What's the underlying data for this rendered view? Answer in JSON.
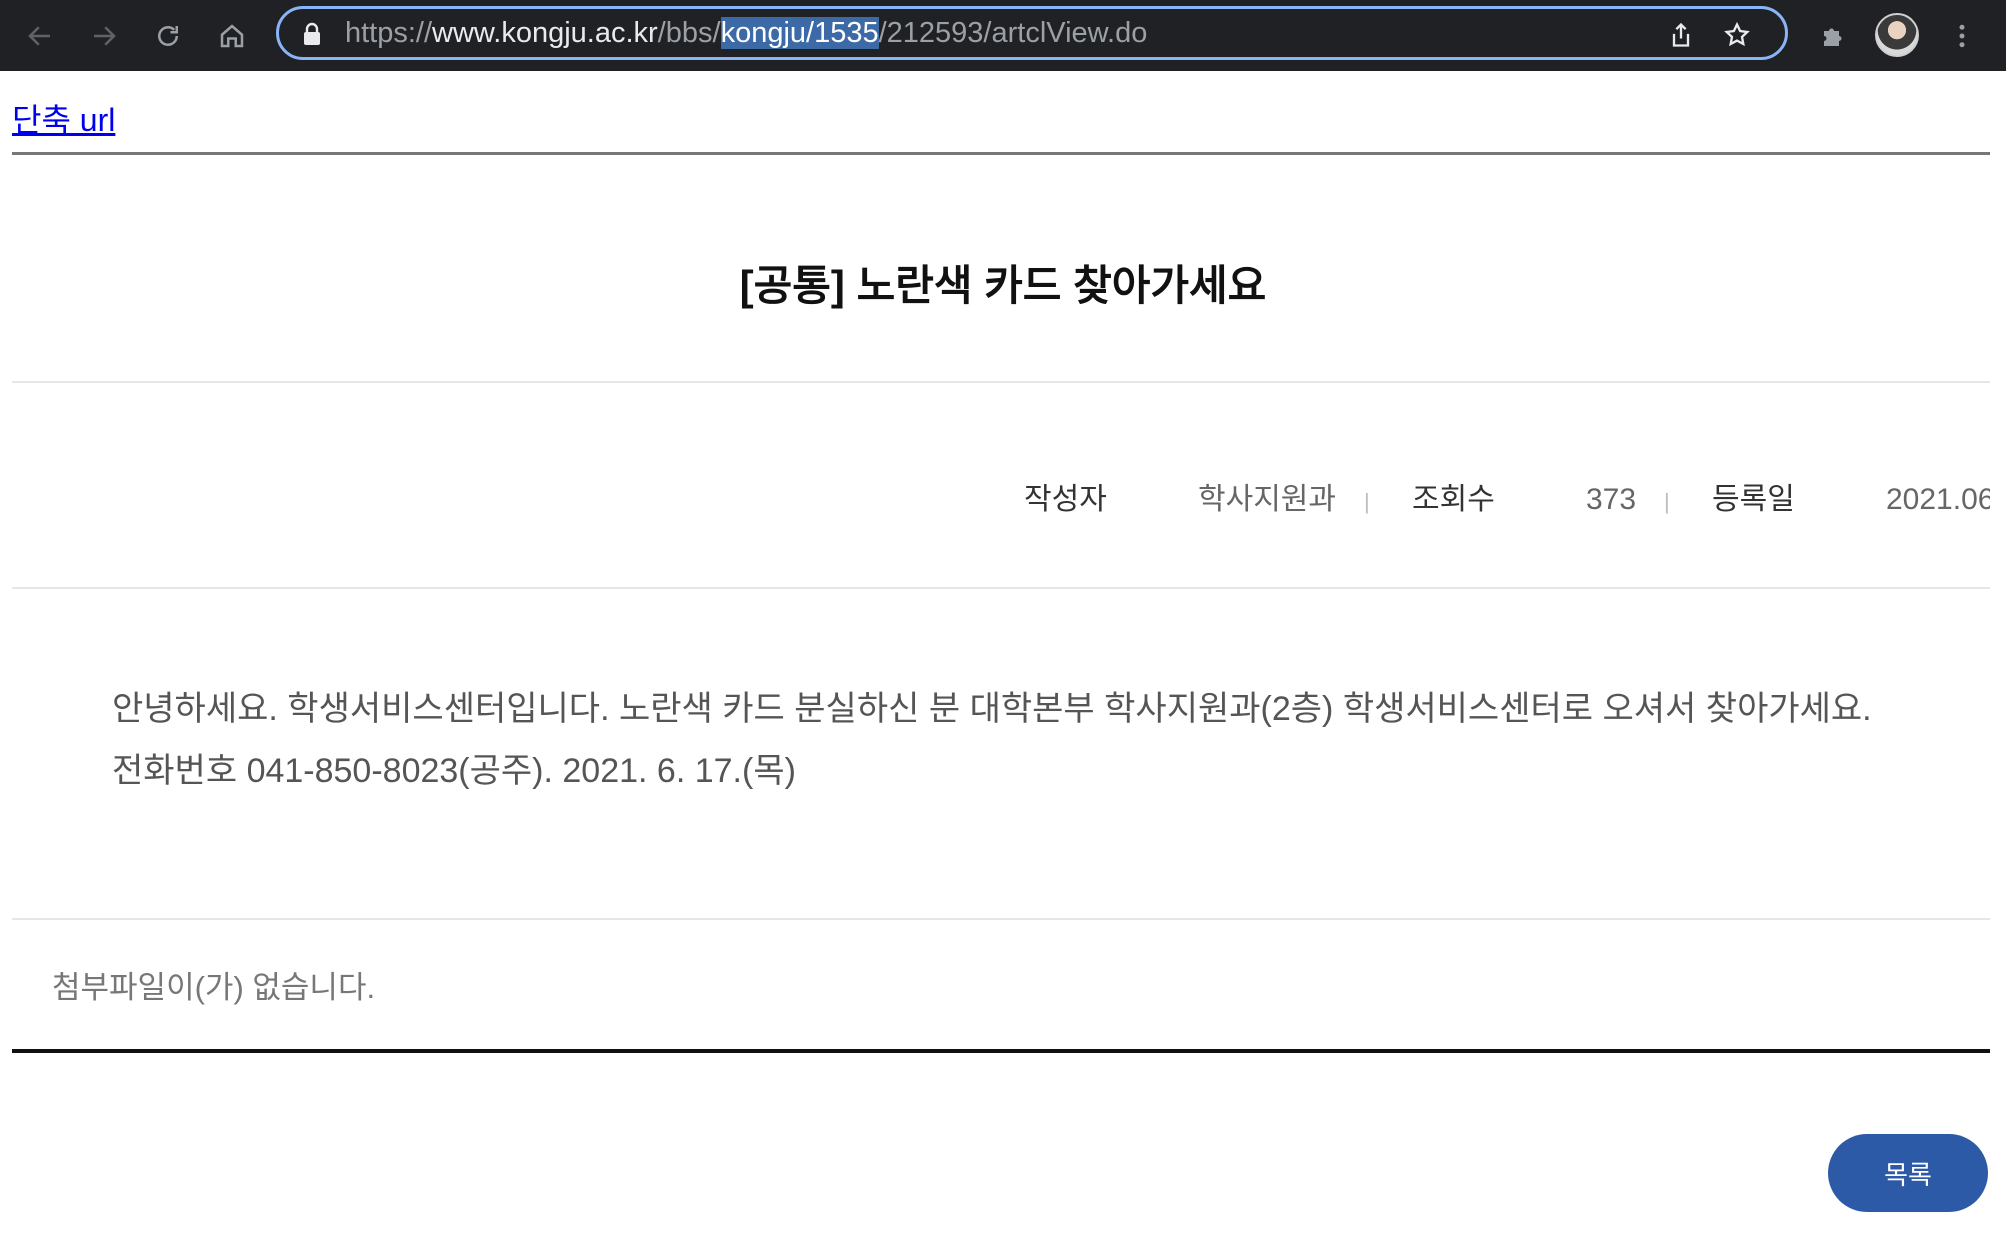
{
  "browser": {
    "url_prefix": "https://",
    "url_domain": "www.kongju.ac.kr",
    "url_path_a": "/bbs/",
    "url_selected": "kongju/1535",
    "url_path_b": "/212593/artclView.do",
    "colors": {
      "toolbar": "#202124",
      "focus_ring": "#8ab4f8",
      "selection": "#3c6aa7"
    }
  },
  "page": {
    "short_url_label": "단축 url",
    "title": "[공통] 노란색 카드 찾아가세요",
    "meta": {
      "author_label": "작성자",
      "author_value": "학사지원과",
      "views_label": "조회수",
      "views_value": "373",
      "date_label": "등록일",
      "date_value": "2021.06",
      "separator": "|"
    },
    "content_line1": "안녕하세요. 학생서비스센터입니다. 노란색 카드 분실하신 분 대학본부 학사지원과(2층) 학생서비스센터로 오셔서 찾아가세요.",
    "content_line2": "전화번호 041-850-8023(공주). 2021. 6. 17.(목)",
    "attachment_text": "첨부파일이(가) 없습니다.",
    "list_button": "목록",
    "colors": {
      "link": "#0000ee",
      "button": "#2d5aa6"
    }
  }
}
